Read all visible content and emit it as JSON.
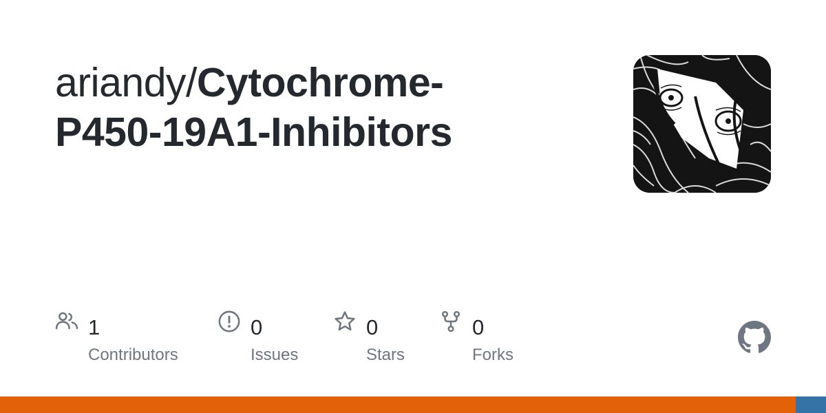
{
  "repo": {
    "owner": "ariandy/",
    "name_line1": "Cytochrome-",
    "name_line2": "P450-19A1-Inhibitors"
  },
  "stats": [
    {
      "count": "1",
      "label": "Contributors",
      "icon": "people-icon"
    },
    {
      "count": "0",
      "label": "Issues",
      "icon": "issue-icon"
    },
    {
      "count": "0",
      "label": "Stars",
      "icon": "star-icon"
    },
    {
      "count": "0",
      "label": "Forks",
      "icon": "fork-icon"
    }
  ],
  "logo": {
    "icon": "github-icon",
    "color": "#6e7781"
  },
  "language_bar": [
    {
      "color": "#e36209",
      "percent": 96.3
    },
    {
      "color": "#3572a5",
      "percent": 3.7
    }
  ],
  "colors": {
    "text": "#24292f",
    "muted": "#6e7781",
    "icon": "#6e7781"
  }
}
